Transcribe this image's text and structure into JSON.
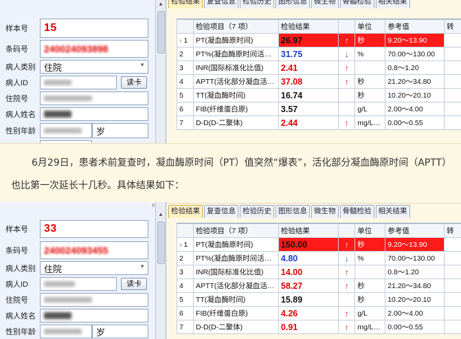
{
  "tabs": [
    "检验结果",
    "复查信息",
    "检验历史",
    "图形信息",
    "微生物",
    "骨髓检验",
    "相关结果"
  ],
  "labels": {
    "sample_no": "样本号",
    "barcode": "条码号",
    "patient_type": "病人类别",
    "patient_id": "病人ID",
    "admission_no": "住院号",
    "patient_name": "病人姓名",
    "sex_age": "性别年龄",
    "read_card": "读卡",
    "age_unit": "岁"
  },
  "table_header": {
    "item": "检验项目（7 项）",
    "result": "检验结果",
    "unit": "单位",
    "reference": "参考值"
  },
  "panel1": {
    "sample_no": "15",
    "barcode": "240024093898",
    "patient_type": "住院",
    "rows": [
      {
        "idx": "1",
        "item": "PT(凝血酶原时间)",
        "result": "26.97",
        "flag": "↑",
        "unit": "秒",
        "ref": "9.20～13.90",
        "color": "red",
        "highlight": true
      },
      {
        "idx": "2",
        "item": "PT%(凝血酶原时间活…",
        "result": "31.75",
        "flag": "↓",
        "unit": "%",
        "ref": "70.00～130.00",
        "color": "blue",
        "highlight": false
      },
      {
        "idx": "3",
        "item": "INR(国际标准化比值)",
        "result": "2.41",
        "flag": "↑",
        "unit": "",
        "ref": "0.8～1.20",
        "color": "red",
        "highlight": false
      },
      {
        "idx": "4",
        "item": "APTT(活化部分凝血活…",
        "result": "37.08",
        "flag": "↑",
        "unit": "秒",
        "ref": "21.20～34.80",
        "color": "red",
        "highlight": false
      },
      {
        "idx": "5",
        "item": "TT(凝血酶时间)",
        "result": "16.74",
        "flag": "",
        "unit": "秒",
        "ref": "10.20～20.10",
        "color": "black",
        "highlight": false
      },
      {
        "idx": "6",
        "item": "FIB(纤维蛋白原)",
        "result": "3.57",
        "flag": "",
        "unit": "g/L",
        "ref": "2.00～4.00",
        "color": "black",
        "highlight": false
      },
      {
        "idx": "7",
        "item": "D-D(D-二聚体)",
        "result": "2.44",
        "flag": "↑",
        "unit": "mg/L…",
        "ref": "0.00～0.55",
        "color": "red",
        "highlight": false
      }
    ]
  },
  "caption": "6月29日，患者术前复查时，凝血酶原时间（PT）值突然“爆表”，活化部分凝血酶原时间（APTT）也比第一次延长十几秒。具体结果如下：",
  "panel2": {
    "sample_no": "33",
    "barcode": "240024093455",
    "patient_type": "住院",
    "rows": [
      {
        "idx": "1",
        "item": "PT(凝血酶原时间)",
        "result": "150.00",
        "flag": "↑",
        "unit": "秒",
        "ref": "9.20～13.90",
        "color": "red",
        "highlight": true
      },
      {
        "idx": "2",
        "item": "PT%(凝血酶原时间活…",
        "result": "4.80",
        "flag": "↓",
        "unit": "%",
        "ref": "70.00～130.00",
        "color": "blue",
        "highlight": false
      },
      {
        "idx": "3",
        "item": "INR(国际标准化比值)",
        "result": "14.00",
        "flag": "↑",
        "unit": "",
        "ref": "0.8～1.20",
        "color": "red",
        "highlight": false
      },
      {
        "idx": "4",
        "item": "APTT(活化部分凝血活…",
        "result": "58.27",
        "flag": "↑",
        "unit": "秒",
        "ref": "21.20～34.80",
        "color": "red",
        "highlight": false
      },
      {
        "idx": "5",
        "item": "TT(凝血酶时间)",
        "result": "15.89",
        "flag": "",
        "unit": "秒",
        "ref": "10.20～20.10",
        "color": "black",
        "highlight": false
      },
      {
        "idx": "6",
        "item": "FIB(纤维蛋白原)",
        "result": "4.26",
        "flag": "↑",
        "unit": "g/L",
        "ref": "2.00～4.00",
        "color": "red",
        "highlight": false
      },
      {
        "idx": "7",
        "item": "D-D(D-二聚体)",
        "result": "0.91",
        "flag": "↑",
        "unit": "mg/L…",
        "ref": "0.00～0.55",
        "color": "red",
        "highlight": false
      }
    ]
  }
}
